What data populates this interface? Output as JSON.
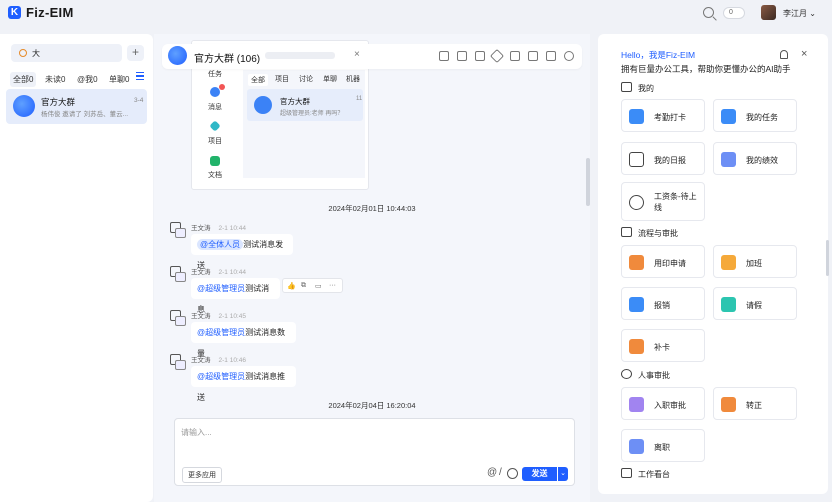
{
  "app": {
    "name": "Fiz-EIM",
    "logo_letter": "K",
    "user": "李江月 ⌄",
    "toggle_value": "0"
  },
  "search": {
    "value": "大",
    "plus": "+"
  },
  "filters": [
    {
      "label": "全部0",
      "active": true
    },
    {
      "label": "未读0",
      "active": false
    },
    {
      "label": "@我0",
      "active": false
    },
    {
      "label": "单聊0",
      "active": false
    }
  ],
  "conversation": {
    "name": "官方大群",
    "preview": "杨伟俊 邀请了 刘苏岳、董云...",
    "time": "3-4"
  },
  "chat": {
    "title": "官方大群 (106)",
    "close": "×",
    "dates": [
      "2024年02月01日 10:44:03",
      "2024年02月04日 16:20:04"
    ],
    "messages": [
      {
        "sender": "王文涛",
        "time": "2-1 10:44",
        "mention": "@全体人员",
        "text": "测试消息发送"
      },
      {
        "sender": "王文涛",
        "time": "2-1 10:44",
        "mention": "@超级管理员",
        "text": "测试消息"
      },
      {
        "sender": "王文涛",
        "time": "2-1 10:45",
        "mention": "@超级管理员",
        "text": "测试消息数量"
      },
      {
        "sender": "王文涛",
        "time": "2-1 10:46",
        "mention": "@超级管理员",
        "text": "测试消息推送"
      }
    ],
    "reactions": [
      "👍",
      "⧉",
      "▭",
      "···"
    ],
    "input_placeholder": "请输入...",
    "more_apps": "更多应用",
    "at": "@",
    "slash": "/",
    "send": "发送",
    "send_drop": "⌄"
  },
  "preview": {
    "side": [
      "任务",
      "消息",
      "项目",
      "文档"
    ],
    "tabs": [
      "全部",
      "项目",
      "讨论",
      "单聊",
      "机器"
    ],
    "item": {
      "name": "官方大群",
      "sub": "超级管理员:老师 再吗？",
      "time": "11"
    }
  },
  "ai": {
    "hello": "Hello，我是Fiz-EIM",
    "sub": "拥有巨量办公工具，帮助你更懂办公的AI助手",
    "close": "×",
    "sections": {
      "mine": "我的",
      "flow": "流程与审批",
      "hr": "人事审批",
      "dash": "工作看台"
    },
    "tiles_mine": [
      "考勤打卡",
      "我的任务",
      "我的日报",
      "我的绩效",
      "工资条-待上线"
    ],
    "tiles_flow": [
      "用印申请",
      "加班",
      "报销",
      "请假",
      "补卡"
    ],
    "tiles_hr": [
      "入职审批",
      "转正",
      "离职"
    ]
  },
  "colors": {
    "accent": "#1f5eff",
    "orange": "#f08a3c",
    "teal": "#2cc5b0",
    "purple": "#a184f0"
  }
}
